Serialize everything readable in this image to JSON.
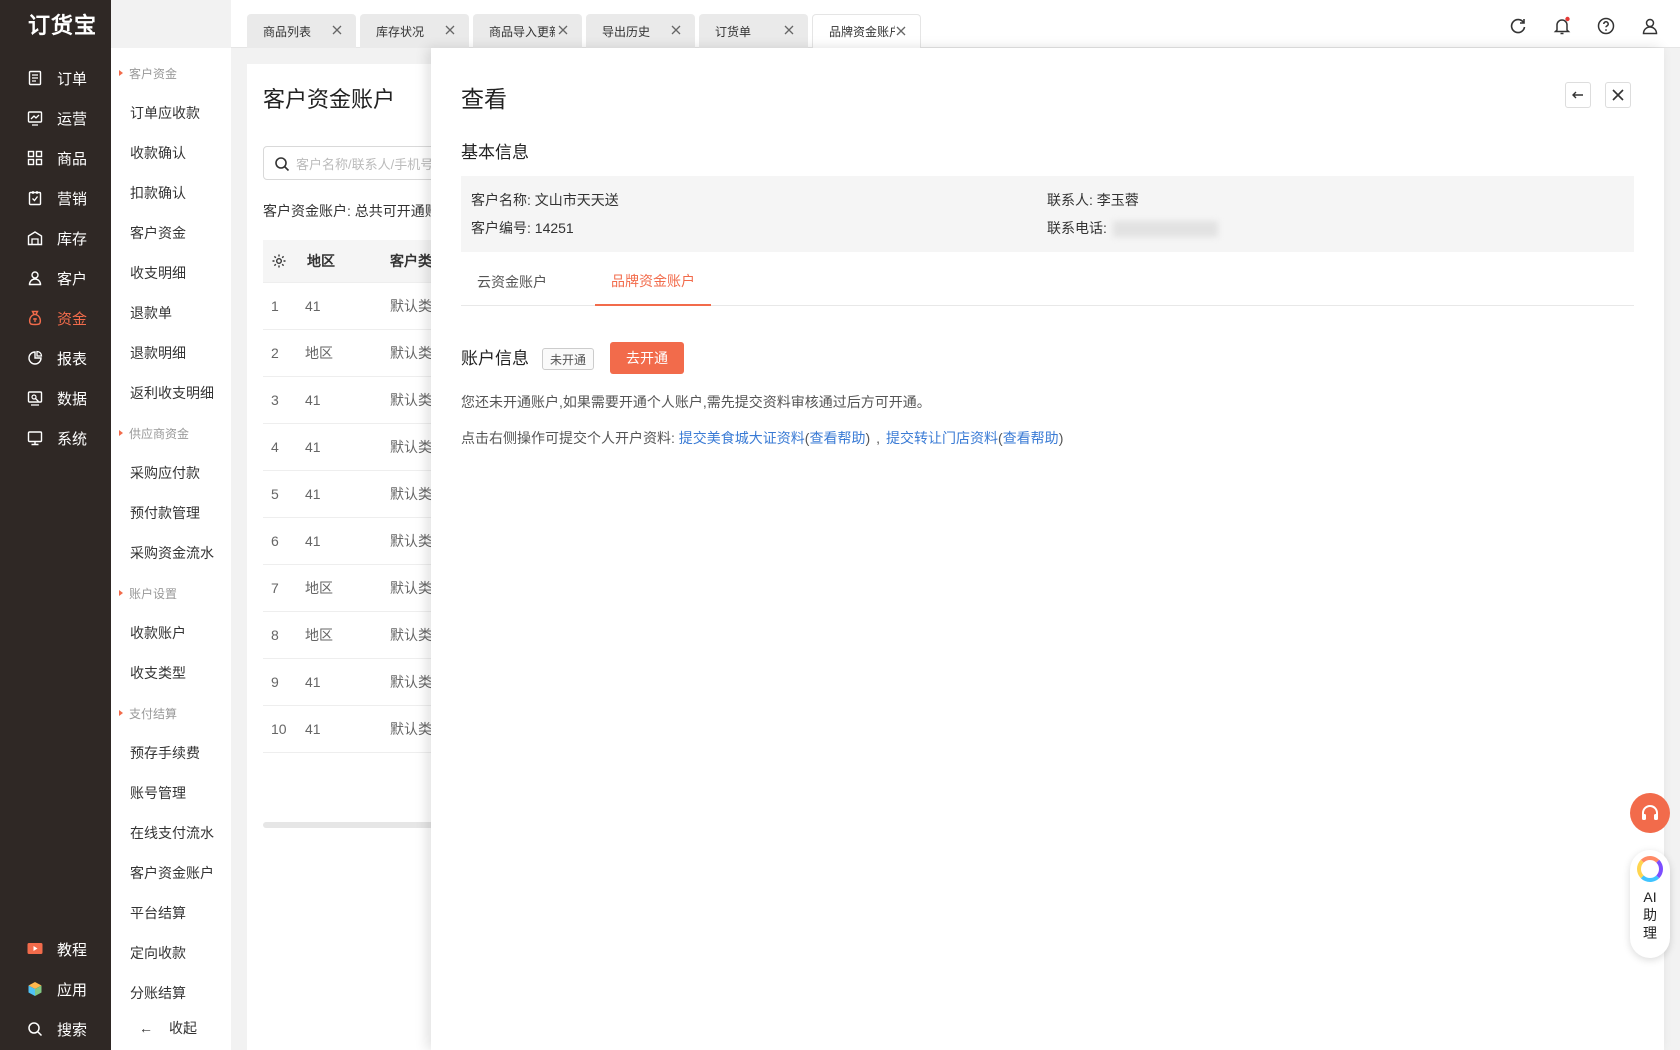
{
  "app": {
    "logo": "订货宝"
  },
  "nav": {
    "items": [
      {
        "label": "订单",
        "icon": "order-icon"
      },
      {
        "label": "运营",
        "icon": "operation-icon"
      },
      {
        "label": "商品",
        "icon": "product-icon"
      },
      {
        "label": "营销",
        "icon": "marketing-icon"
      },
      {
        "label": "库存",
        "icon": "warehouse-icon"
      },
      {
        "label": "客户",
        "icon": "customer-icon"
      },
      {
        "label": "资金",
        "icon": "money-bag-icon",
        "active": true
      },
      {
        "label": "报表",
        "icon": "pie-chart-icon"
      },
      {
        "label": "数据",
        "icon": "data-icon"
      },
      {
        "label": "系统",
        "icon": "monitor-icon"
      }
    ],
    "bottom": [
      {
        "label": "教程",
        "icon": "video-icon"
      },
      {
        "label": "应用",
        "icon": "cube-icon"
      },
      {
        "label": "搜索",
        "icon": "search-icon"
      }
    ]
  },
  "submenu": {
    "groups": [
      {
        "title": "客户资金",
        "items": [
          "订单应收款",
          "收款确认",
          "扣款确认",
          "客户资金",
          "收支明细",
          "退款单",
          "退款明细",
          "返利收支明细"
        ]
      },
      {
        "title": "供应商资金",
        "items": [
          "采购应付款",
          "预付款管理",
          "采购资金流水"
        ]
      },
      {
        "title": "账户设置",
        "items": [
          "收款账户",
          "收支类型"
        ]
      },
      {
        "title": "支付结算",
        "items": [
          "预存手续费",
          "账号管理",
          "在线支付流水",
          "客户资金账户",
          "平台结算",
          "定向收款",
          "分账结算"
        ]
      }
    ],
    "collapse_label": "收起"
  },
  "tabs": [
    "商品列表",
    "库存状况",
    "商品导入更新",
    "导出历史",
    "订货单",
    "品牌资金账户"
  ],
  "tabs_active_index": 5,
  "under": {
    "title": "客户资金账户",
    "search_placeholder": "客户名称/联系人/手机号",
    "summary": "客户资金账户: 总共可开通账户",
    "columns": [
      "地区",
      "客户类型"
    ],
    "rows": [
      {
        "no": "1",
        "c1": "41",
        "c2": "默认类型"
      },
      {
        "no": "2",
        "c1": "地区",
        "c2": "默认类型"
      },
      {
        "no": "3",
        "c1": "41",
        "c2": "默认类型"
      },
      {
        "no": "4",
        "c1": "41",
        "c2": "默认类型"
      },
      {
        "no": "5",
        "c1": "41",
        "c2": "默认类型"
      },
      {
        "no": "6",
        "c1": "41",
        "c2": "默认类型"
      },
      {
        "no": "7",
        "c1": "地区",
        "c2": "默认类型"
      },
      {
        "no": "8",
        "c1": "地区",
        "c2": "默认类型"
      },
      {
        "no": "9",
        "c1": "41",
        "c2": "默认类型"
      },
      {
        "no": "10",
        "c1": "41",
        "c2": "默认类型"
      }
    ]
  },
  "drawer": {
    "title": "查看",
    "basic_info_title": "基本信息",
    "customer_name_label": "客户名称:",
    "customer_name": "文山市天天送",
    "customer_no_label": "客户编号:",
    "customer_no": "14251",
    "contact_label": "联系人:",
    "contact": "李玉蓉",
    "phone_label": "联系电话:",
    "tabs": [
      "云资金账户",
      "品牌资金账户"
    ],
    "active_tab_index": 1,
    "account_title": "账户信息",
    "account_status": "未开通",
    "open_button": "去开通",
    "note": "您还未开通账户,如果需要开通个人账户,需先提交资料审核通过后方可开通。",
    "links_prefix": "点击右侧操作可提交个人开户资料:",
    "link1": "提交美食城大证资料",
    "help1": "查看帮助",
    "link2": "提交转让门店资料",
    "help2": "查看帮助",
    "paren_open": "(",
    "paren_close": ")",
    "sep": ",",
    "paren_open2": "(",
    "paren_close2": ")"
  },
  "float": {
    "ai_label": "AI助理"
  },
  "colors": {
    "accent": "#f26b4b",
    "nav_bg": "#2f2825",
    "link": "#3a7bd5"
  }
}
